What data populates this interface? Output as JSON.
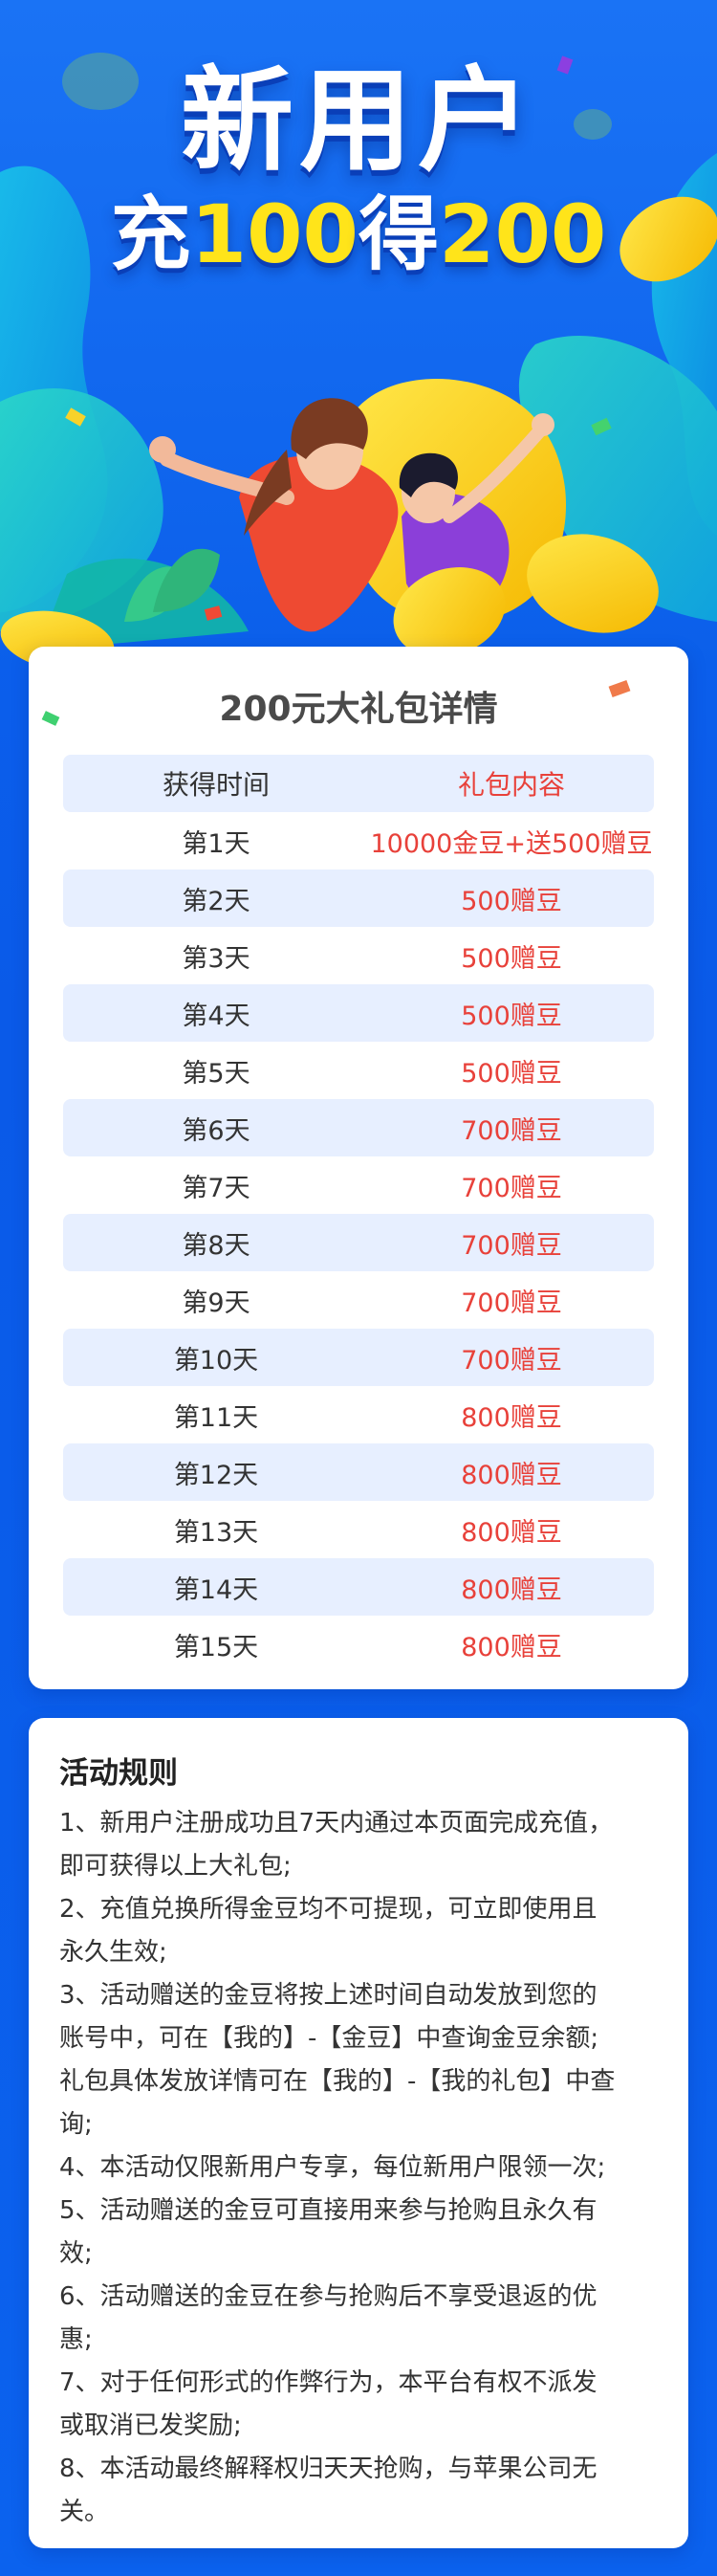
{
  "hero": {
    "title": "新用户",
    "sub_prefix": "充",
    "sub_num1": "100",
    "sub_mid": "得",
    "sub_num2": "200"
  },
  "gift": {
    "title": "200元大礼包详情",
    "header": {
      "time": "获得时间",
      "content": "礼包内容"
    },
    "rows": [
      {
        "day": "第1天",
        "reward": "10000金豆+送500赠豆"
      },
      {
        "day": "第2天",
        "reward": "500赠豆"
      },
      {
        "day": "第3天",
        "reward": "500赠豆"
      },
      {
        "day": "第4天",
        "reward": "500赠豆"
      },
      {
        "day": "第5天",
        "reward": "500赠豆"
      },
      {
        "day": "第6天",
        "reward": "700赠豆"
      },
      {
        "day": "第7天",
        "reward": "700赠豆"
      },
      {
        "day": "第8天",
        "reward": "700赠豆"
      },
      {
        "day": "第9天",
        "reward": "700赠豆"
      },
      {
        "day": "第10天",
        "reward": "700赠豆"
      },
      {
        "day": "第11天",
        "reward": "800赠豆"
      },
      {
        "day": "第12天",
        "reward": "800赠豆"
      },
      {
        "day": "第13天",
        "reward": "800赠豆"
      },
      {
        "day": "第14天",
        "reward": "800赠豆"
      },
      {
        "day": "第15天",
        "reward": "800赠豆"
      }
    ]
  },
  "rules": {
    "title": "活动规则",
    "lines": [
      "1、新用户注册成功且7天内通过本页面完成充值，",
      "即可获得以上大礼包;",
      "2、充值兑换所得金豆均不可提现，可立即使用且",
      "永久生效;",
      "3、活动赠送的金豆将按上述时间自动发放到您的",
      "账号中，可在【我的】-【金豆】中查询金豆余额;",
      "礼包具体发放详情可在【我的】-【我的礼包】中查",
      "询;",
      "4、本活动仅限新用户专享，每位新用户限领一次;",
      "5、活动赠送的金豆可直接用来参与抢购且永久有",
      "效;",
      "6、活动赠送的金豆在参与抢购后不享受退返的优",
      "惠;",
      "7、对于任何形式的作弊行为，本平台有权不派发",
      "或取消已发奖励;",
      "8、本活动最终解释权归天天抢购，与苹果公司无",
      "关。"
    ]
  },
  "colors": {
    "bg_blue": "#0b62ee",
    "title_yellow": "#ffe41a",
    "reward_red": "#e8413a",
    "row_shade": "#e7efff"
  }
}
